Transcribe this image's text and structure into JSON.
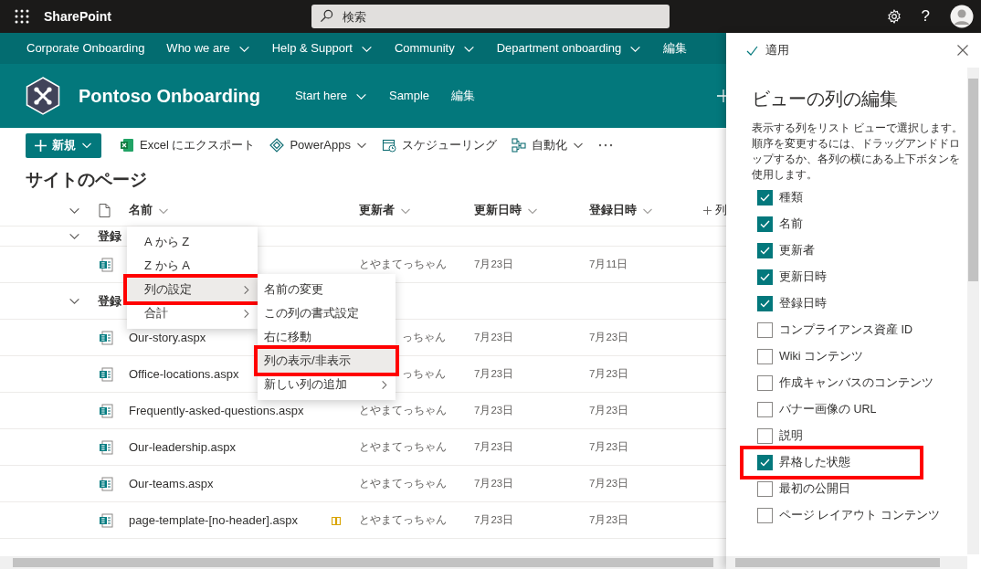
{
  "top_bar": {
    "app_name": "SharePoint",
    "search": {
      "placeholder": "検索"
    },
    "help": "?"
  },
  "hub_nav": [
    {
      "label": "Corporate Onboarding",
      "has_dropdown": false
    },
    {
      "label": "Who we are",
      "has_dropdown": true
    },
    {
      "label": "Help & Support",
      "has_dropdown": true
    },
    {
      "label": "Community",
      "has_dropdown": true
    },
    {
      "label": "Department onboarding",
      "has_dropdown": true
    },
    {
      "label": "編集",
      "has_dropdown": false
    }
  ],
  "site": {
    "title": "Pontoso Onboarding",
    "nav": [
      {
        "label": "Start here",
        "has_dropdown": true
      },
      {
        "label": "Sample",
        "has_dropdown": false
      },
      {
        "label": "編集",
        "has_dropdown": false
      }
    ]
  },
  "command_bar": [
    {
      "kind": "new",
      "label": "新規",
      "has_dropdown": true
    },
    {
      "kind": "excel",
      "label": "Excel にエクスポート",
      "has_dropdown": false
    },
    {
      "kind": "powerapps",
      "label": "PowerApps",
      "has_dropdown": true
    },
    {
      "kind": "schedule",
      "label": "スケジューリング",
      "has_dropdown": false
    },
    {
      "kind": "automate",
      "label": "自動化",
      "has_dropdown": true
    },
    {
      "kind": "more"
    }
  ],
  "list": {
    "title": "サイトのページ",
    "columns": [
      {
        "label": "名前"
      },
      {
        "label": "更新者"
      },
      {
        "label": "更新日時"
      },
      {
        "label": "登録日時"
      }
    ],
    "add_column": "列",
    "rows": [
      {
        "kind": "group",
        "label": "登録"
      },
      {
        "kind": "page",
        "modifier": "とやまてっちゃん",
        "modifier_cut": false,
        "modified": "7月23日",
        "created": "7月11日"
      },
      {
        "kind": "group",
        "label": "登録"
      },
      {
        "kind": "page",
        "name": "Our-story.aspx",
        "modifier": "っちゃん",
        "modifier_cut": true,
        "modified": "7月23日",
        "created": "7月23日"
      },
      {
        "kind": "page",
        "name": "Office-locations.aspx",
        "modifier": "っちゃん",
        "modifier_cut": true,
        "modified": "7月23日",
        "created": "7月23日"
      },
      {
        "kind": "page",
        "name": "Frequently-asked-questions.aspx",
        "modifier": "とやまてっちゃん",
        "modifier_cut": false,
        "modified": "7月23日",
        "created": "7月23日"
      },
      {
        "kind": "page",
        "name": "Our-leadership.aspx",
        "modifier": "とやまてっちゃん",
        "modifier_cut": false,
        "modified": "7月23日",
        "created": "7月23日"
      },
      {
        "kind": "page",
        "name": "Our-teams.aspx",
        "modifier": "とやまてっちゃん",
        "modifier_cut": false,
        "modified": "7月23日",
        "created": "7月23日"
      },
      {
        "kind": "template",
        "name": "page-template-[no-header].aspx",
        "modifier": "とやまてっちゃん",
        "modifier_cut": false,
        "modified": "7月23日",
        "created": "7月23日"
      }
    ]
  },
  "column_menu": {
    "items": [
      {
        "label": "A から Z",
        "has_submenu": false,
        "highlighted": false
      },
      {
        "label": "Z から A",
        "has_submenu": false,
        "highlighted": false
      },
      {
        "label": "列の設定",
        "has_submenu": true,
        "highlighted": true
      },
      {
        "label": "合計",
        "has_submenu": true,
        "highlighted": false
      }
    ]
  },
  "submenu": {
    "items": [
      {
        "label": "名前の変更",
        "has_submenu": false,
        "highlighted": false
      },
      {
        "label": "この列の書式設定",
        "has_submenu": false,
        "highlighted": false
      },
      {
        "label": "右に移動",
        "has_submenu": false,
        "highlighted": false
      },
      {
        "label": "列の表示/非表示",
        "has_submenu": false,
        "highlighted": true
      },
      {
        "label": "新しい列の追加",
        "has_submenu": true,
        "highlighted": false
      }
    ]
  },
  "panel": {
    "apply": "適用",
    "title": "ビューの列の編集",
    "description": "表示する列をリスト ビューで選択します。順序を変更するには、ドラッグアンドドロップするか、各列の横にある上下ボタンを使用します。",
    "columns": [
      {
        "label": "種類",
        "checked": true,
        "highlighted": false
      },
      {
        "label": "名前",
        "checked": true,
        "highlighted": false
      },
      {
        "label": "更新者",
        "checked": true,
        "highlighted": false
      },
      {
        "label": "更新日時",
        "checked": true,
        "highlighted": false
      },
      {
        "label": "登録日時",
        "checked": true,
        "highlighted": false
      },
      {
        "label": "コンプライアンス資産 ID",
        "checked": false,
        "highlighted": false
      },
      {
        "label": "Wiki コンテンツ",
        "checked": false,
        "highlighted": false
      },
      {
        "label": "作成キャンバスのコンテンツ",
        "checked": false,
        "highlighted": false
      },
      {
        "label": "バナー画像の URL",
        "checked": false,
        "highlighted": false
      },
      {
        "label": "説明",
        "checked": false,
        "highlighted": false
      },
      {
        "label": "昇格した状態",
        "checked": true,
        "highlighted": true
      },
      {
        "label": "最初の公開日",
        "checked": false,
        "highlighted": false
      },
      {
        "label": "ページ レイアウト コンテンツ",
        "checked": false,
        "highlighted": false
      }
    ]
  }
}
